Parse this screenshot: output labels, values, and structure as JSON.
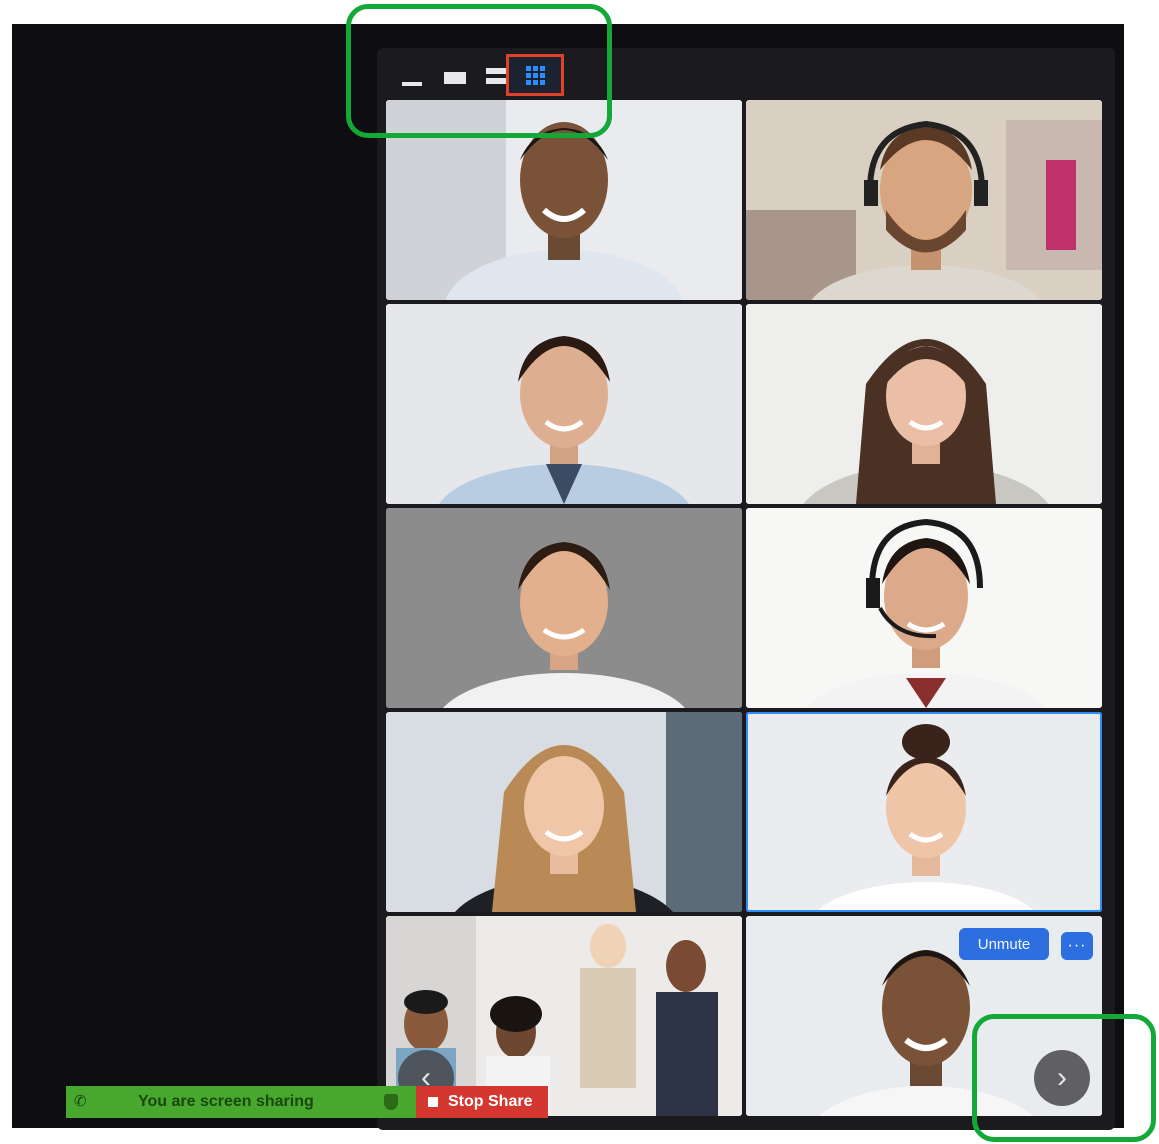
{
  "window": {
    "view_options": [
      "minimize-view-icon",
      "speaker-view-icon",
      "stacked-view-icon",
      "gallery-view-icon"
    ],
    "selected_view": "gallery-view-icon"
  },
  "participants": [
    {
      "description": "man in white shirt smiling"
    },
    {
      "description": "man with headset in office"
    },
    {
      "description": "man in light blue shirt"
    },
    {
      "description": "woman with brown hair smiling"
    },
    {
      "description": "man in front of grey wall"
    },
    {
      "description": "man with call-center headset"
    },
    {
      "description": "woman with long blonde hair"
    },
    {
      "description": "woman with hair in bun"
    },
    {
      "description": "group meeting at table"
    },
    {
      "description": "man smiling, muted"
    }
  ],
  "controls": {
    "unmute_label": "Unmute",
    "more_label": "···",
    "prev_page_icon": "‹",
    "next_page_icon": "›"
  },
  "share_bar": {
    "status_text": "You are screen sharing",
    "stop_label": "Stop Share"
  },
  "colors": {
    "accent_blue": "#2d8cff",
    "highlight_red": "#e0412a",
    "share_green": "#48a82e",
    "stop_red": "#d3372f",
    "annotation_green": "#14a838"
  }
}
